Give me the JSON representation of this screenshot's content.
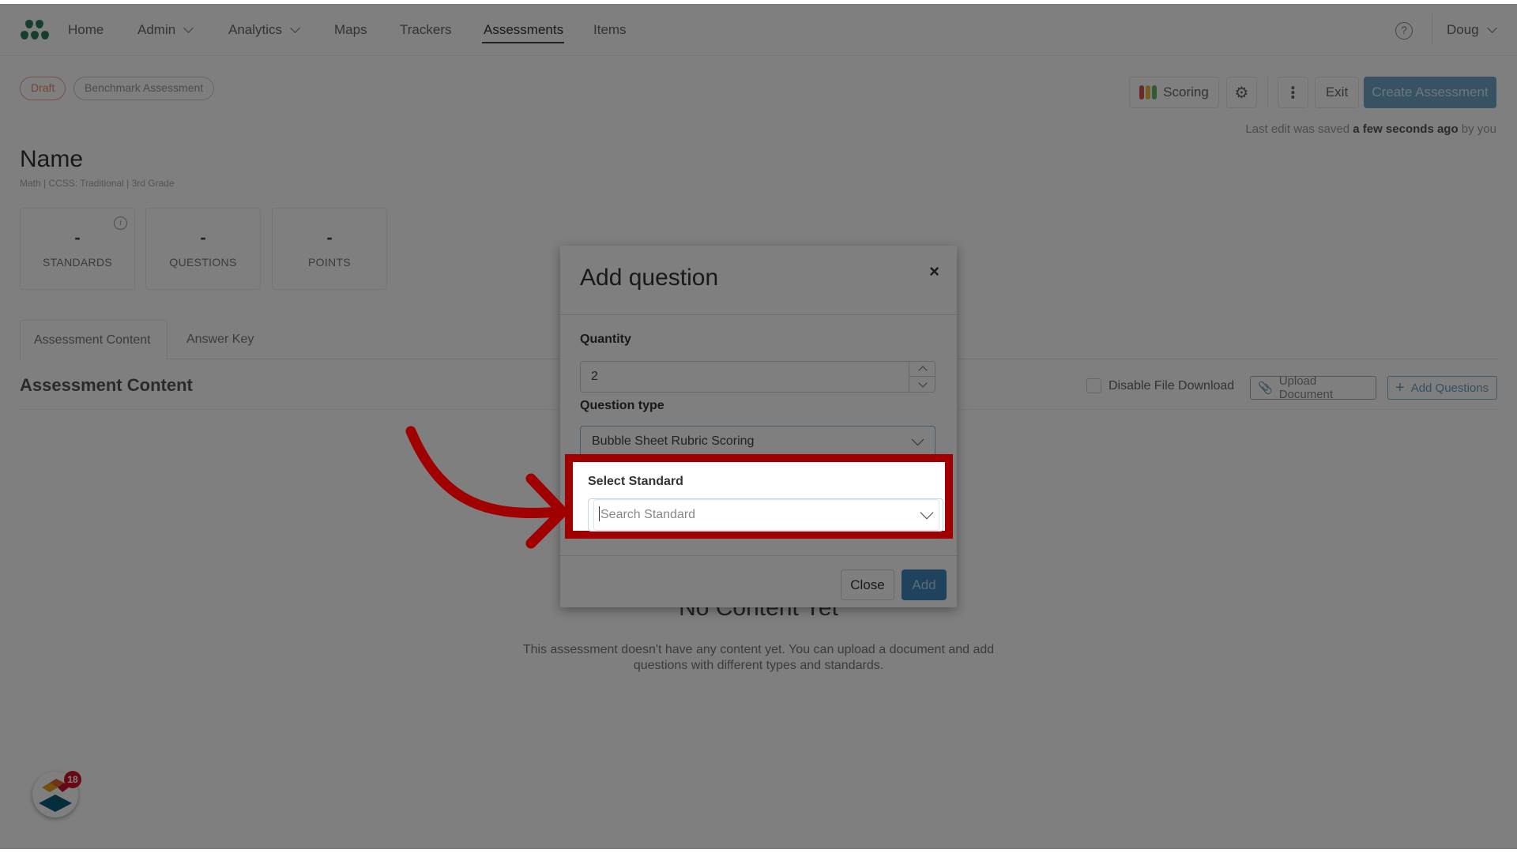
{
  "nav": {
    "items": [
      {
        "label": "Home",
        "has_dropdown": false
      },
      {
        "label": "Admin",
        "has_dropdown": true
      },
      {
        "label": "Analytics",
        "has_dropdown": true
      },
      {
        "label": "Maps",
        "has_dropdown": false
      },
      {
        "label": "Trackers",
        "has_dropdown": false
      },
      {
        "label": "Assessments",
        "has_dropdown": false,
        "active": true
      },
      {
        "label": "Items",
        "has_dropdown": false
      }
    ],
    "help_icon": "?",
    "user": "Doug"
  },
  "header": {
    "status_badge": "Draft",
    "type_badge": "Benchmark Assessment",
    "scoring_label": "Scoring",
    "exit_label": "Exit",
    "create_label": "Create Assessment",
    "saved_prefix": "Last edit was saved ",
    "saved_time": "a few seconds ago",
    "saved_suffix": " by you",
    "title": "Name",
    "subtitle": "Math  |  CCSS: Traditional  |  3rd Grade"
  },
  "stats": [
    {
      "value": "-",
      "label": "STANDARDS",
      "has_info": true
    },
    {
      "value": "-",
      "label": "QUESTIONS"
    },
    {
      "value": "-",
      "label": "POINTS"
    }
  ],
  "tabs": [
    {
      "label": "Assessment Content",
      "active": true
    },
    {
      "label": "Answer Key",
      "active": false
    }
  ],
  "content": {
    "section_title": "Assessment Content",
    "disable_download_label": "Disable File Download",
    "disable_download_checked": false,
    "upload_label": "Upload Document",
    "add_questions_label": "Add Questions",
    "empty_title": "No Content Yet",
    "empty_desc": "This assessment doesn't have any content yet. You can upload a document and add questions with different types and standards."
  },
  "launcher": {
    "badge_count": "18"
  },
  "modal": {
    "title": "Add question",
    "close_icon": "×",
    "quantity_label": "Quantity",
    "quantity_value": "2",
    "question_type_label": "Question type",
    "question_type_value": "Bubble Sheet Rubric Scoring",
    "standard_label": "Select Standard",
    "standard_placeholder": "Search Standard",
    "close_label": "Close",
    "add_label": "Add"
  },
  "colors": {
    "brand_green": "#2f7d5b",
    "primary_blue": "#3e86b8",
    "highlight_red": "#a00000",
    "draft_orange": "#e8876c",
    "badge_red": "#d0112b"
  }
}
